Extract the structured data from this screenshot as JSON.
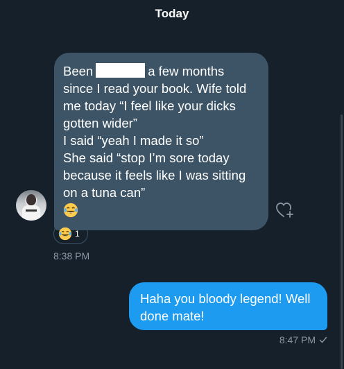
{
  "header": {
    "date_label": "Today"
  },
  "received_message": {
    "lines": [
      "Been",
      "a few months",
      "since I read your book. Wife told",
      "me today “I feel like your dicks",
      "gotten wider”",
      "I said “yeah I made it so”",
      "She said “stop I’m sore today",
      "because it feels like I was sitting",
      "on a tuna can”"
    ],
    "emoji": "tears-of-joy-emoji",
    "time": "8:38 PM",
    "reaction": {
      "emoji": "tears-of-joy-emoji",
      "count": "1"
    }
  },
  "sent_message": {
    "lines": [
      "Haha you bloody legend! Well",
      "done mate!"
    ],
    "time": "8:47 PM",
    "status_icon": "check-icon"
  },
  "colors": {
    "background": "#15202b",
    "received_bubble": "#3d5466",
    "sent_bubble": "#1d9bf0",
    "timestamp": "#8b98a5",
    "scrollbar": "#3a4654"
  }
}
